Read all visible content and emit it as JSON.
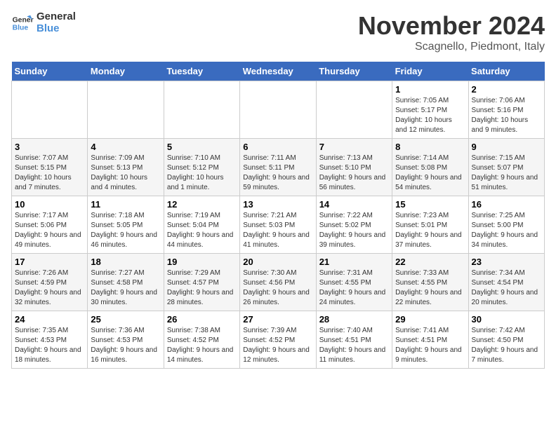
{
  "logo": {
    "line1": "General",
    "line2": "Blue"
  },
  "title": "November 2024",
  "location": "Scagnello, Piedmont, Italy",
  "weekdays": [
    "Sunday",
    "Monday",
    "Tuesday",
    "Wednesday",
    "Thursday",
    "Friday",
    "Saturday"
  ],
  "weeks": [
    [
      {
        "day": "",
        "info": ""
      },
      {
        "day": "",
        "info": ""
      },
      {
        "day": "",
        "info": ""
      },
      {
        "day": "",
        "info": ""
      },
      {
        "day": "",
        "info": ""
      },
      {
        "day": "1",
        "info": "Sunrise: 7:05 AM\nSunset: 5:17 PM\nDaylight: 10 hours and 12 minutes."
      },
      {
        "day": "2",
        "info": "Sunrise: 7:06 AM\nSunset: 5:16 PM\nDaylight: 10 hours and 9 minutes."
      }
    ],
    [
      {
        "day": "3",
        "info": "Sunrise: 7:07 AM\nSunset: 5:15 PM\nDaylight: 10 hours and 7 minutes."
      },
      {
        "day": "4",
        "info": "Sunrise: 7:09 AM\nSunset: 5:13 PM\nDaylight: 10 hours and 4 minutes."
      },
      {
        "day": "5",
        "info": "Sunrise: 7:10 AM\nSunset: 5:12 PM\nDaylight: 10 hours and 1 minute."
      },
      {
        "day": "6",
        "info": "Sunrise: 7:11 AM\nSunset: 5:11 PM\nDaylight: 9 hours and 59 minutes."
      },
      {
        "day": "7",
        "info": "Sunrise: 7:13 AM\nSunset: 5:10 PM\nDaylight: 9 hours and 56 minutes."
      },
      {
        "day": "8",
        "info": "Sunrise: 7:14 AM\nSunset: 5:08 PM\nDaylight: 9 hours and 54 minutes."
      },
      {
        "day": "9",
        "info": "Sunrise: 7:15 AM\nSunset: 5:07 PM\nDaylight: 9 hours and 51 minutes."
      }
    ],
    [
      {
        "day": "10",
        "info": "Sunrise: 7:17 AM\nSunset: 5:06 PM\nDaylight: 9 hours and 49 minutes."
      },
      {
        "day": "11",
        "info": "Sunrise: 7:18 AM\nSunset: 5:05 PM\nDaylight: 9 hours and 46 minutes."
      },
      {
        "day": "12",
        "info": "Sunrise: 7:19 AM\nSunset: 5:04 PM\nDaylight: 9 hours and 44 minutes."
      },
      {
        "day": "13",
        "info": "Sunrise: 7:21 AM\nSunset: 5:03 PM\nDaylight: 9 hours and 41 minutes."
      },
      {
        "day": "14",
        "info": "Sunrise: 7:22 AM\nSunset: 5:02 PM\nDaylight: 9 hours and 39 minutes."
      },
      {
        "day": "15",
        "info": "Sunrise: 7:23 AM\nSunset: 5:01 PM\nDaylight: 9 hours and 37 minutes."
      },
      {
        "day": "16",
        "info": "Sunrise: 7:25 AM\nSunset: 5:00 PM\nDaylight: 9 hours and 34 minutes."
      }
    ],
    [
      {
        "day": "17",
        "info": "Sunrise: 7:26 AM\nSunset: 4:59 PM\nDaylight: 9 hours and 32 minutes."
      },
      {
        "day": "18",
        "info": "Sunrise: 7:27 AM\nSunset: 4:58 PM\nDaylight: 9 hours and 30 minutes."
      },
      {
        "day": "19",
        "info": "Sunrise: 7:29 AM\nSunset: 4:57 PM\nDaylight: 9 hours and 28 minutes."
      },
      {
        "day": "20",
        "info": "Sunrise: 7:30 AM\nSunset: 4:56 PM\nDaylight: 9 hours and 26 minutes."
      },
      {
        "day": "21",
        "info": "Sunrise: 7:31 AM\nSunset: 4:55 PM\nDaylight: 9 hours and 24 minutes."
      },
      {
        "day": "22",
        "info": "Sunrise: 7:33 AM\nSunset: 4:55 PM\nDaylight: 9 hours and 22 minutes."
      },
      {
        "day": "23",
        "info": "Sunrise: 7:34 AM\nSunset: 4:54 PM\nDaylight: 9 hours and 20 minutes."
      }
    ],
    [
      {
        "day": "24",
        "info": "Sunrise: 7:35 AM\nSunset: 4:53 PM\nDaylight: 9 hours and 18 minutes."
      },
      {
        "day": "25",
        "info": "Sunrise: 7:36 AM\nSunset: 4:53 PM\nDaylight: 9 hours and 16 minutes."
      },
      {
        "day": "26",
        "info": "Sunrise: 7:38 AM\nSunset: 4:52 PM\nDaylight: 9 hours and 14 minutes."
      },
      {
        "day": "27",
        "info": "Sunrise: 7:39 AM\nSunset: 4:52 PM\nDaylight: 9 hours and 12 minutes."
      },
      {
        "day": "28",
        "info": "Sunrise: 7:40 AM\nSunset: 4:51 PM\nDaylight: 9 hours and 11 minutes."
      },
      {
        "day": "29",
        "info": "Sunrise: 7:41 AM\nSunset: 4:51 PM\nDaylight: 9 hours and 9 minutes."
      },
      {
        "day": "30",
        "info": "Sunrise: 7:42 AM\nSunset: 4:50 PM\nDaylight: 9 hours and 7 minutes."
      }
    ]
  ]
}
